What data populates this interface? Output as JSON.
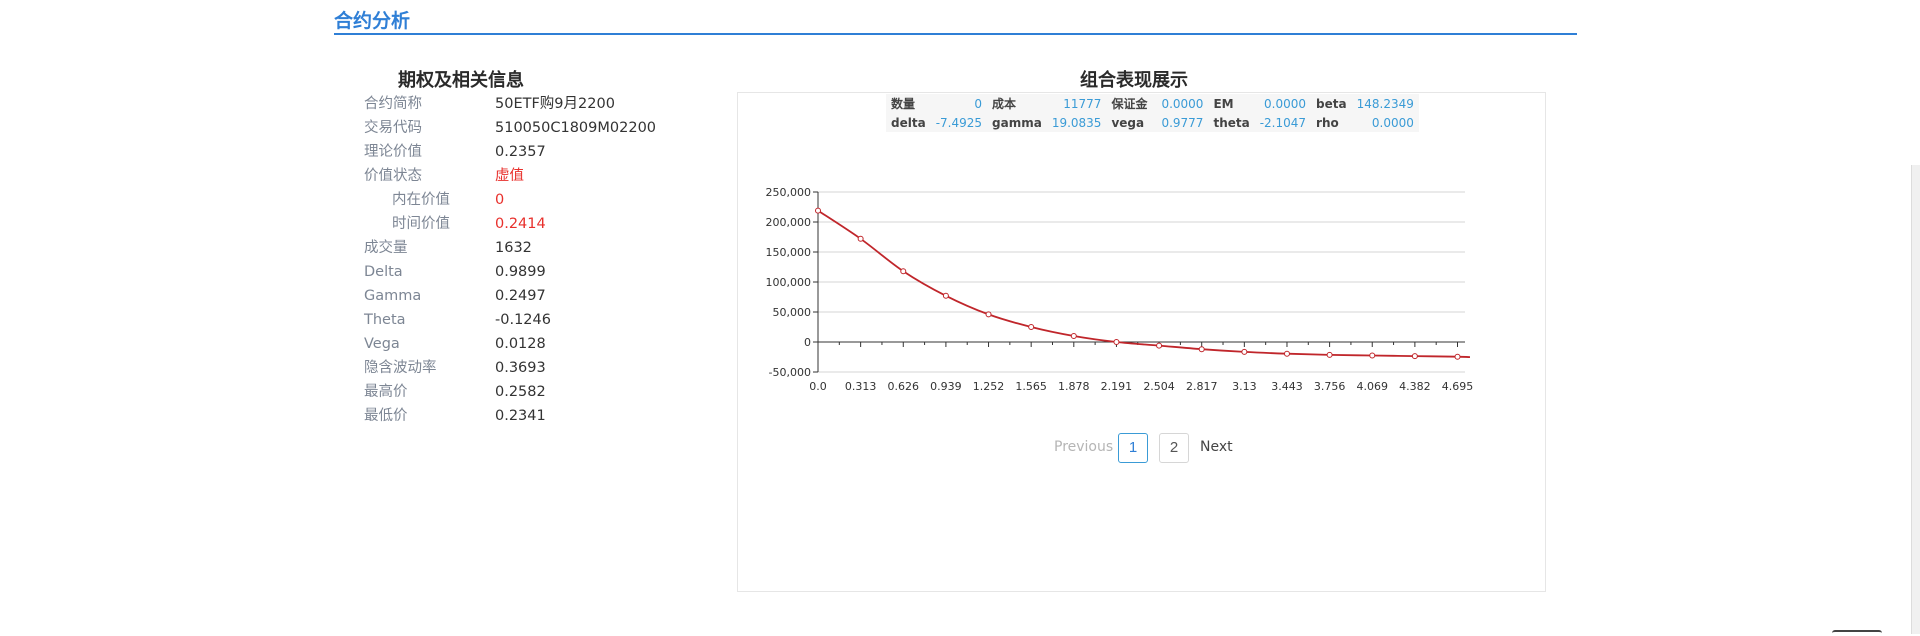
{
  "section": {
    "title": "合约分析"
  },
  "left_panel": {
    "title": "期权及相关信息",
    "rows": [
      {
        "label": "合约简称",
        "value": "50ETF购9月2200"
      },
      {
        "label": "交易代码",
        "value": "510050C1809M02200"
      },
      {
        "label": "理论价值",
        "value": "0.2357"
      },
      {
        "label": "价值状态",
        "value": "虚值"
      },
      {
        "label": "内在价值",
        "value": "0"
      },
      {
        "label": "时间价值",
        "value": "0.2414"
      },
      {
        "label": "成交量",
        "value": "1632"
      },
      {
        "label": "Delta",
        "value": "0.9899"
      },
      {
        "label": "Gamma",
        "value": "0.2497"
      },
      {
        "label": "Theta",
        "value": "-0.1246"
      },
      {
        "label": "Vega",
        "value": "0.0128"
      },
      {
        "label": "隐含波动率",
        "value": "0.3693"
      },
      {
        "label": "最高价",
        "value": "0.2582"
      },
      {
        "label": "最低价",
        "value": "0.2341"
      }
    ]
  },
  "right_panel": {
    "title": "组合表现展示",
    "stats": [
      [
        {
          "k": "数量",
          "v": "0"
        },
        {
          "k": "成本",
          "v": "11777"
        },
        {
          "k": "保证金",
          "v": "0.0000"
        },
        {
          "k": "EM",
          "v": "0.0000"
        },
        {
          "k": "beta",
          "v": "148.2349"
        }
      ],
      [
        {
          "k": "delta",
          "v": "-7.4925"
        },
        {
          "k": "gamma",
          "v": "19.0835"
        },
        {
          "k": "vega",
          "v": "0.9777"
        },
        {
          "k": "theta",
          "v": "-2.1047"
        },
        {
          "k": "rho",
          "v": "0.0000"
        }
      ]
    ],
    "pagination": {
      "prev": "Previous",
      "pages": [
        "1",
        "2"
      ],
      "active": "1",
      "next": "Next"
    }
  },
  "colors": {
    "accent": "#2f7fd6",
    "line": "#c0262b",
    "red_text": "#e8302c",
    "stat_value": "#3a9bd6"
  },
  "chart_data": {
    "type": "line",
    "title": "",
    "xlabel": "",
    "ylabel": "",
    "x": [
      0.0,
      0.313,
      0.626,
      0.939,
      1.252,
      1.565,
      1.878,
      2.191,
      2.504,
      2.817,
      3.13,
      3.443,
      3.756,
      4.069,
      4.382,
      4.695
    ],
    "x_tick_labels": [
      "0.0",
      "0.313",
      "0.626",
      "0.939",
      "1.252",
      "1.565",
      "1.878",
      "2.191",
      "2.504",
      "2.817",
      "3.13",
      "3.443",
      "3.756",
      "4.069",
      "4.382",
      "4.695"
    ],
    "series": [
      {
        "values": [
          219000,
          172000,
          118000,
          77000,
          46000,
          25000,
          10000,
          0,
          -6000,
          -12000,
          -16500,
          -19500,
          -21500,
          -22500,
          -23500,
          -24500
        ]
      }
    ],
    "x_range": [
      0.0,
      4.75
    ],
    "ylim": [
      -50000,
      250000
    ],
    "y_ticks": [
      -50000,
      0,
      50000,
      100000,
      150000,
      200000,
      250000
    ],
    "y_tick_labels": [
      "-50,000",
      "0",
      "50,000",
      "100,000",
      "150,000",
      "200,000",
      "250,000"
    ],
    "grid": true,
    "legend": "none"
  }
}
